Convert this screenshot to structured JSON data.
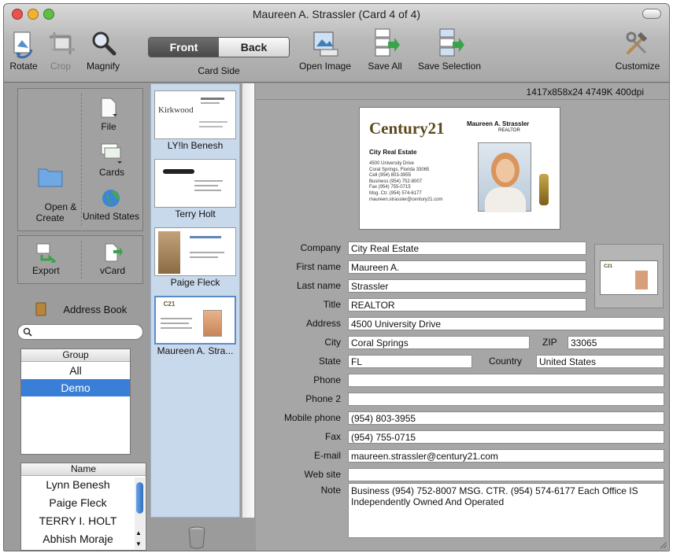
{
  "window": {
    "title": "Maureen A. Strassler  (Card 4 of 4)",
    "colors": {
      "close": "#e7524c",
      "minimize": "#f1b132",
      "zoom": "#5fbf43",
      "selection": "#3a7fd7"
    }
  },
  "toolbar": {
    "rotate": "Rotate",
    "crop": "Crop",
    "magnify": "Magnify",
    "front": "Front",
    "back": "Back",
    "card_side": "Card Side",
    "open_image": "Open Image",
    "save_all": "Save All",
    "save_selection": "Save Selection",
    "customize": "Customize"
  },
  "sidebar": {
    "file": "File",
    "open_create": "Open &\nCreate",
    "cards": "Cards",
    "region": "United States",
    "export": "Export",
    "vcard": "vCard",
    "address_book": "Address Book",
    "search_placeholder": "",
    "group_header": "Group",
    "groups": [
      "All",
      "Demo"
    ],
    "selected_group": "Demo",
    "name_header": "Name",
    "names": [
      "Lynn Benesh",
      "Paige Fleck",
      "TERRY I. HOLT",
      "Abhish  Moraje"
    ]
  },
  "cards": [
    {
      "name": "LY!ln Benesh",
      "thumb_text": "Kirkwood"
    },
    {
      "name": "Terry Holt",
      "thumb_text": ""
    },
    {
      "name": "Paige Fleck",
      "thumb_text": ""
    },
    {
      "name": "Maureen A. Stra...",
      "thumb_text": ""
    }
  ],
  "main": {
    "image_info": "1417x858x24  4749K  400dpi",
    "card_image": {
      "brand": "Century21",
      "office": "City Real Estate",
      "person": "Maureen A. Strassler",
      "role": "REALTOR",
      "lines": [
        "4500 University Drive",
        "Coral Springs, Florida 33065",
        "Cell (954) 803-3955",
        "Business (954) 752-8007",
        "Fax (954) 755-0715",
        "Msg. Ctr. (954) 574-6177",
        "maureen.strassler@century21.com"
      ]
    },
    "fields": {
      "company_label": "Company",
      "company": "City Real Estate",
      "first_label": "First name",
      "first": "Maureen A.",
      "last_label": "Last name",
      "last": "Strassler",
      "title_label": "Title",
      "title": "REALTOR",
      "address_label": "Address",
      "address": "4500 University Drive",
      "city_label": "City",
      "city": "Coral Springs",
      "zip_label": "ZIP",
      "zip": "33065",
      "state_label": "State",
      "state": "FL",
      "country_label": "Country",
      "country": "United States",
      "phone_label": "Phone",
      "phone": "",
      "phone2_label": "Phone 2",
      "phone2": "",
      "mobile_label": "Mobile phone",
      "mobile": "(954) 803-3955",
      "fax_label": "Fax",
      "fax": "(954) 755-0715",
      "email_label": "E-mail",
      "email": "maureen.strassler@century21.com",
      "web_label": "Web site",
      "web": "",
      "note_label": "Note",
      "note": "Business (954) 752-8007 MSG. CTR. (954) 574-6177 Each Office IS Independently Owned And Operated"
    }
  }
}
